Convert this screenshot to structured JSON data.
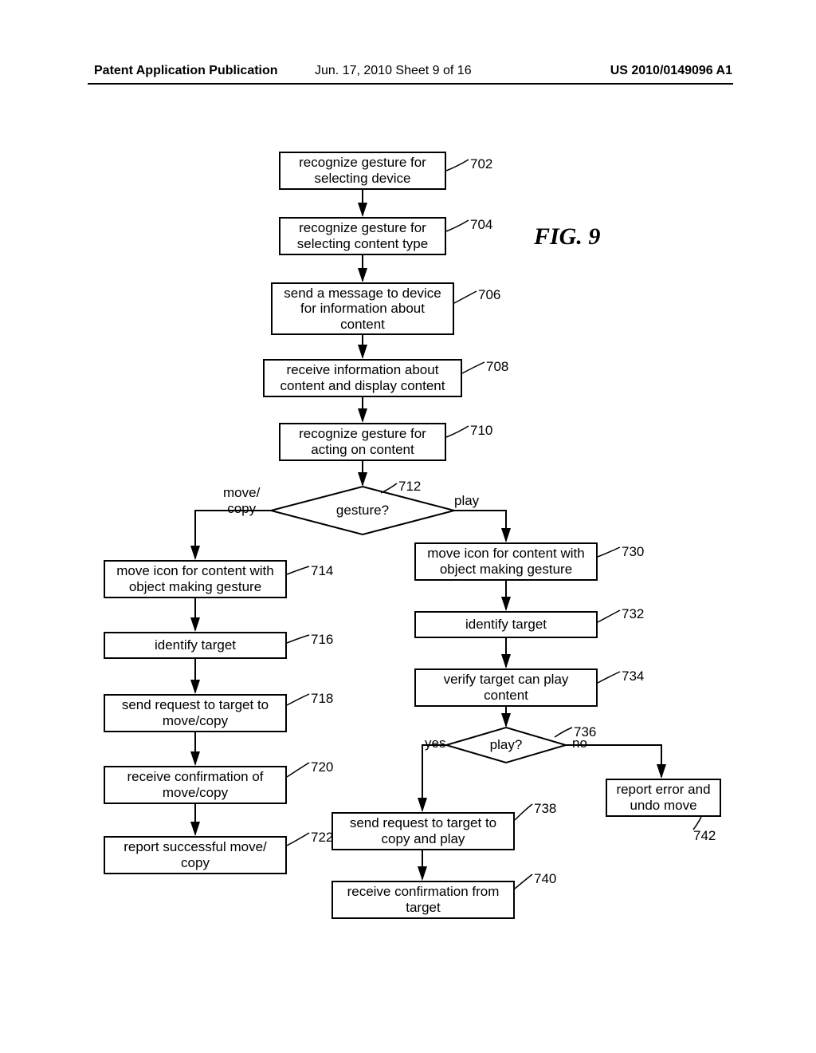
{
  "header": {
    "left": "Patent Application Publication",
    "mid": "Jun. 17, 2010  Sheet 9 of 16",
    "right": "US 2010/0149096 A1"
  },
  "figure_label": "FIG. 9",
  "boxes": {
    "b702": "recognize gesture for\nselecting device",
    "b704": "recognize gesture for\nselecting content type",
    "b706": "send a message to device\nfor information about\ncontent",
    "b708": "receive information about\ncontent and display content",
    "b710": "recognize gesture for\nacting on content",
    "b714": "move icon for content with\nobject making gesture",
    "b716": "identify target",
    "b718": "send request to target to\nmove/copy",
    "b720": "receive confirmation of\nmove/copy",
    "b722": "report successful move/\ncopy",
    "b730": "move icon for content with\nobject making gesture",
    "b732": "identify target",
    "b734": "verify target can play\ncontent",
    "b738": "send request to target to\ncopy and play",
    "b740": "receive confirmation from\ntarget",
    "b742": "report error and\nundo move"
  },
  "diamonds": {
    "d712": "gesture?",
    "d736": "play?"
  },
  "refs": {
    "r702": "702",
    "r704": "704",
    "r706": "706",
    "r708": "708",
    "r710": "710",
    "r712": "712",
    "r714": "714",
    "r716": "716",
    "r718": "718",
    "r720": "720",
    "r722": "722",
    "r730": "730",
    "r732": "732",
    "r734": "734",
    "r736": "736",
    "r738": "738",
    "r740": "740",
    "r742": "742"
  },
  "edge_labels": {
    "move_copy": "move/\ncopy",
    "play": "play",
    "yes": "yes",
    "no": "no"
  }
}
